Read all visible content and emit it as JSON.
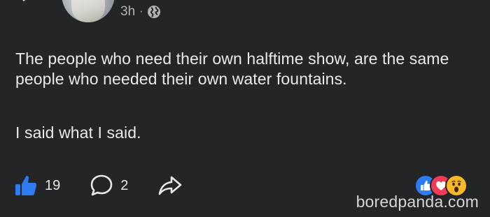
{
  "header": {
    "timestamp": "3h",
    "separator": "·",
    "audience_icon": "globe-icon",
    "back_icon": "chevron-left-icon",
    "more_icon": "more-horizontal-icon"
  },
  "post": {
    "paragraph_1": "The people who need their own halftime show, are the same people who needed their own water fountains.",
    "paragraph_2": "I said what I said."
  },
  "actions": {
    "like_count": "19",
    "comment_count": "2",
    "like_icon": "thumbs-up-icon",
    "comment_icon": "comment-bubble-icon",
    "share_icon": "share-arrow-icon"
  },
  "reactions": {
    "types": [
      "like",
      "love",
      "wow"
    ],
    "colors": {
      "like": "#2f7bf2",
      "love": "#f23a59",
      "wow": "#f7b928"
    }
  },
  "watermark": {
    "text": "boredpanda.com"
  },
  "colors": {
    "background": "#232526",
    "text": "#e8eaed",
    "meta": "#b0b3b8",
    "like_accent": "#2f7bf2"
  }
}
